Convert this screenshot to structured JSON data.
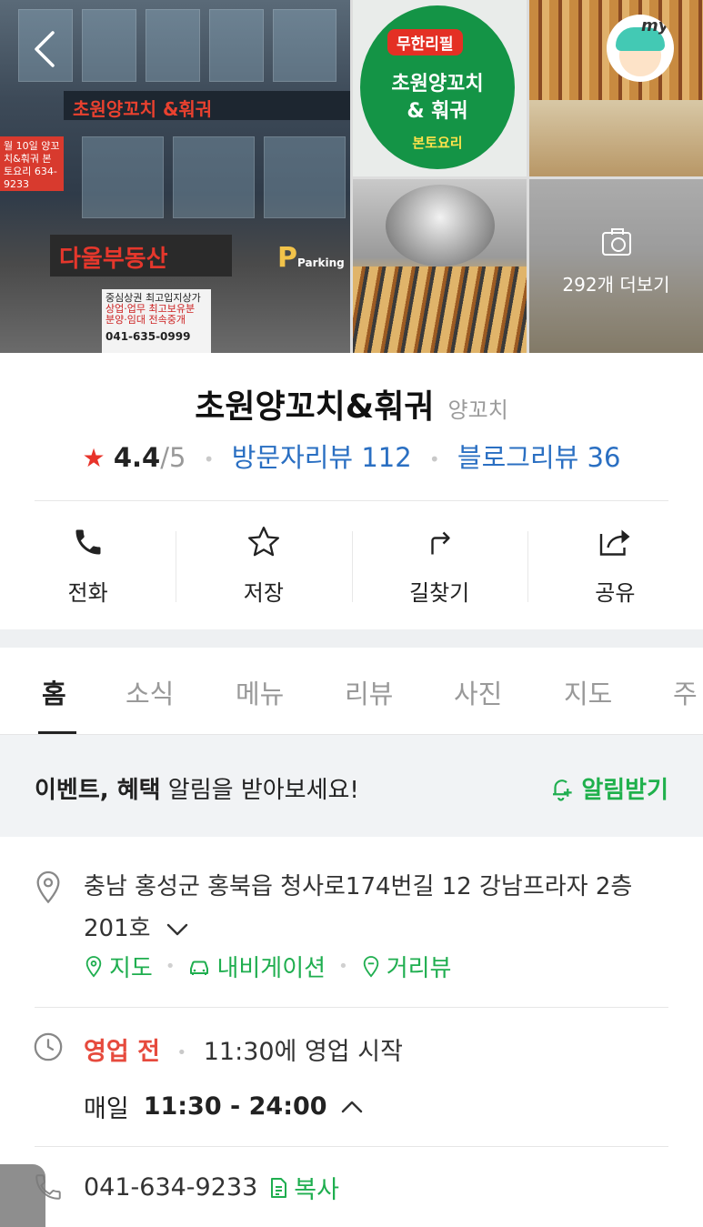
{
  "gallery": {
    "storefront": {
      "main_sign": "초원양꼬치 &훠궈",
      "realty_sign": "다울부동산",
      "banner_text": "월 10일 양꼬치&훠궈 본토요리 634-9233",
      "parking_text": "Parking",
      "board_lines": [
        "중심상권 최고입지상가",
        "상업·업무 최고보유분",
        "분양·임대 전속중개"
      ],
      "board_phone": "041-635-0999"
    },
    "logo": {
      "tag": "무한리필",
      "name_line1": "초원양꼬치",
      "name_line2": "& 훠궈",
      "sub": "본토요리"
    },
    "more_label": "292개 더보기"
  },
  "header": {
    "avatar_text": "my"
  },
  "place": {
    "name": "초원양꼬치&훠궈",
    "category": "양꼬치",
    "rating": "4.4",
    "rating_max": "/5",
    "visitor_reviews": "방문자리뷰 112",
    "blog_reviews": "블로그리뷰 36"
  },
  "actions": [
    {
      "label": "전화",
      "icon": "phone-icon"
    },
    {
      "label": "저장",
      "icon": "star-icon"
    },
    {
      "label": "길찾기",
      "icon": "directions-icon"
    },
    {
      "label": "공유",
      "icon": "share-icon"
    }
  ],
  "tabs": [
    "홈",
    "소식",
    "메뉴",
    "리뷰",
    "사진",
    "지도",
    "주"
  ],
  "notice": {
    "bold": "이벤트, 혜택",
    "rest": " 알림을 받아보세요!",
    "button": "알림받기"
  },
  "address": {
    "text": "충남 홍성군 홍북읍 청사로174번길 12 강남프라자 2층 201호",
    "links": [
      "지도",
      "내비게이션",
      "거리뷰"
    ]
  },
  "hours": {
    "status": "영업 전",
    "note": "11:30에 영업 시작",
    "day": "매일",
    "time": "11:30 - 24:00"
  },
  "phone": {
    "number": "041-634-9233",
    "copy_label": "복사"
  },
  "colors": {
    "accent_green": "#1fae4f",
    "link_blue": "#2a6fc2",
    "star_red": "#e8332a",
    "status_red": "#e64a3d"
  }
}
